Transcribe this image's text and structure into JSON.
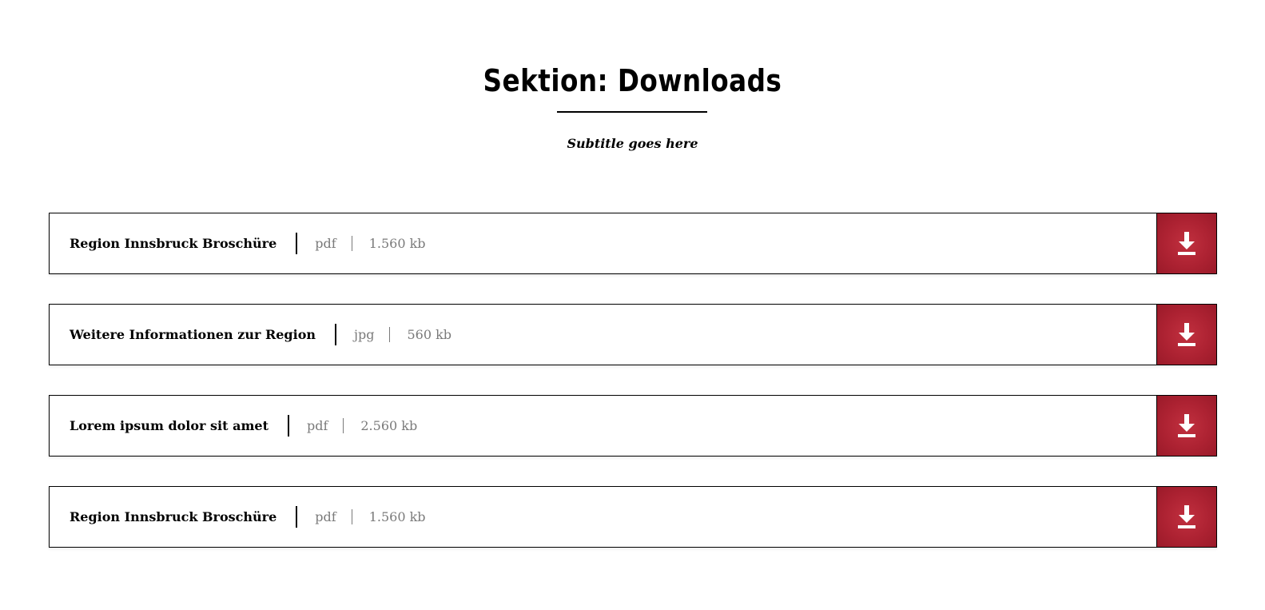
{
  "section": {
    "title": "Sektion: Downloads",
    "subtitle": "Subtitle goes here"
  },
  "downloads": [
    {
      "title": "Region Innsbruck Broschüre",
      "type": "pdf",
      "size": "1.560 kb"
    },
    {
      "title": "Weitere Informationen zur Region",
      "type": "jpg",
      "size": "560 kb"
    },
    {
      "title": "Lorem ipsum dolor sit amet",
      "type": "pdf",
      "size": "2.560 kb"
    },
    {
      "title": "Region Innsbruck Broschüre",
      "type": "pdf",
      "size": "1.560 kb"
    }
  ],
  "icons": {
    "download_button": "download-icon"
  },
  "colors": {
    "accent": "#ad2232",
    "text": "#000000",
    "muted": "#7a7a7a"
  }
}
